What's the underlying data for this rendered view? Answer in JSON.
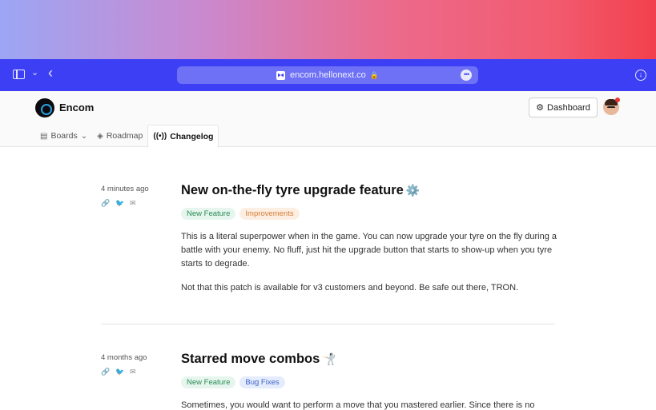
{
  "browser": {
    "url": "encom.hellonext.co"
  },
  "site": {
    "brand": "Encom",
    "dashboard_label": "Dashboard",
    "nav": [
      {
        "label": "Boards",
        "icon": "boards-icon"
      },
      {
        "label": "Roadmap",
        "icon": "roadmap-icon"
      },
      {
        "label": "Changelog",
        "icon": "broadcast-icon",
        "active": true
      }
    ]
  },
  "posts": [
    {
      "time": "4 minutes ago",
      "title": "New on-the-fly tyre upgrade feature",
      "emoji": "⚙️",
      "tags": [
        {
          "label": "New Feature",
          "color": "#2a8a55"
        },
        {
          "label": "Improvements",
          "color": "#d57d34"
        }
      ],
      "paragraphs": [
        "This is a literal superpower when in the game. You can now upgrade your tyre on the fly during a battle with your enemy. No fluff, just hit the upgrade button that starts to show-up when you tyre starts to degrade.",
        "Not that this patch is available for v3 customers and beyond. Be safe out there, TRON."
      ]
    },
    {
      "time": "4 months ago",
      "title": "Starred move combos",
      "emoji": "🤺",
      "tags": [
        {
          "label": "New Feature",
          "color": "#2a8a55"
        },
        {
          "label": "Bug Fixes",
          "color": "#3f63c8"
        }
      ],
      "paragraphs": [
        "Sometimes, you would want to perform a move that you mastered earlier. Since there is no"
      ]
    }
  ]
}
